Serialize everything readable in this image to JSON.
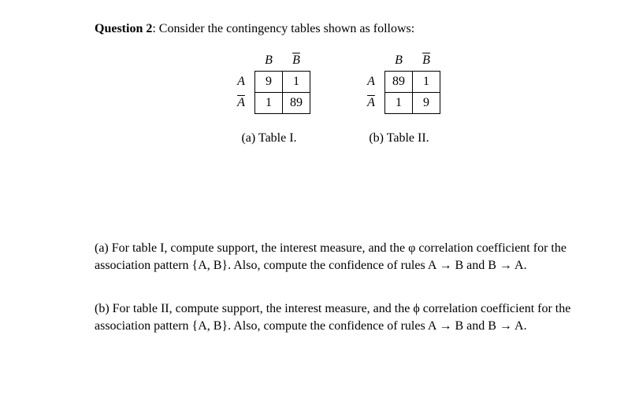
{
  "question": {
    "label": "Question 2",
    "prompt": ": Consider the contingency tables shown as follows:"
  },
  "tables": [
    {
      "col_headers": [
        "B",
        "B̄"
      ],
      "row_headers": [
        "A",
        "Ā"
      ],
      "cells": [
        [
          "9",
          "1"
        ],
        [
          "1",
          "89"
        ]
      ],
      "caption": "(a) Table I."
    },
    {
      "col_headers": [
        "B",
        "B̄"
      ],
      "row_headers": [
        "A",
        "Ā"
      ],
      "cells": [
        [
          "89",
          "1"
        ],
        [
          "1",
          "9"
        ]
      ],
      "caption": "(b) Table II."
    }
  ],
  "parts": {
    "a": "(a) For table I, compute support, the interest measure, and the φ correlation coefficient for the association pattern {A, B}. Also, compute the confidence of rules A → B and B → A.",
    "b": "(b) For table II, compute support, the interest measure, and the ϕ correlation coefficient for the association pattern {A, B}. Also, compute the confidence of rules A → B and B → A."
  },
  "symbols": {
    "B": "B",
    "Bbar": "B",
    "A": "A",
    "Abar": "A"
  },
  "chart_data": [
    {
      "type": "table",
      "name": "Table I",
      "columns": [
        "B",
        "not B"
      ],
      "rows": [
        "A",
        "not A"
      ],
      "values": [
        [
          9,
          1
        ],
        [
          1,
          89
        ]
      ]
    },
    {
      "type": "table",
      "name": "Table II",
      "columns": [
        "B",
        "not B"
      ],
      "rows": [
        "A",
        "not A"
      ],
      "values": [
        [
          89,
          1
        ],
        [
          1,
          9
        ]
      ]
    }
  ]
}
